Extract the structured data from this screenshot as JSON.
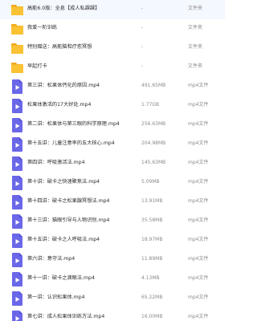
{
  "colors": {
    "folder": "#fbc233",
    "folder_tab": "#f0a91a",
    "video": "#6a67e8",
    "video_dark": "#5350d6",
    "text": "#2c2c2c",
    "muted": "#8a8a8a"
  },
  "files": [
    {
      "name": "高能6.0版：全息【成人私課課】",
      "size": "-",
      "type": "文件夹",
      "icon": "folder-icon"
    },
    {
      "name": "我爱一阶训练",
      "size": "-",
      "type": "文件夹",
      "icon": "folder-icon"
    },
    {
      "name": "特别赠送：高能脑和疗愈冥想",
      "size": "-",
      "type": "文件夹",
      "icon": "folder-icon"
    },
    {
      "name": "早起打卡",
      "size": "-",
      "type": "文件夹",
      "icon": "folder-icon"
    },
    {
      "name": "第三讲：松果体钙化的原因.mp4",
      "size": "491.65MB",
      "type": "mp4文件",
      "icon": "video-file-icon"
    },
    {
      "name": "松果体激活的17大好处.mp4",
      "size": "1.77GB",
      "type": "mp4文件",
      "icon": "video-file-icon"
    },
    {
      "name": "第二讲：松果体与第三眼的科学原理.mp4",
      "size": "256.63MB",
      "type": "mp4文件",
      "icon": "video-file-icon"
    },
    {
      "name": "第十五讲：儿童注意率的五大核心.mp4",
      "size": "204.98MB",
      "type": "mp4文件",
      "icon": "video-file-icon"
    },
    {
      "name": "第四讲：呼吸激活法.mp4",
      "size": "145.63MB",
      "type": "mp4文件",
      "icon": "video-file-icon"
    },
    {
      "name": "第十讲：破卡之快速聚焦法.mp4",
      "size": "5.09MB",
      "type": "mp4文件",
      "icon": "video-file-icon"
    },
    {
      "name": "第十四讲：破卡之松果腺冥想法.mp4",
      "size": "13.91MB",
      "type": "mp4文件",
      "icon": "video-file-icon"
    },
    {
      "name": "第十三讲：猫眼引导与人物识别.mp4",
      "size": "35.58MB",
      "type": "mp4文件",
      "icon": "video-file-icon"
    },
    {
      "name": "第十五讲：破卡之人呼吸法.mp4",
      "size": "18.97MB",
      "type": "mp4文件",
      "icon": "video-file-icon"
    },
    {
      "name": "第六讲：意守法.mp4",
      "size": "11.89MB",
      "type": "mp4文件",
      "icon": "video-file-icon"
    },
    {
      "name": "第十一讲：破卡之滴眼法.mp4",
      "size": "4.13MB",
      "type": "mp4文件",
      "icon": "video-file-icon"
    },
    {
      "name": "第一讲：认识松果体.mp4",
      "size": "65.22MB",
      "type": "mp4文件",
      "icon": "video-file-icon"
    },
    {
      "name": "第七讲：成人松果体训练方法.mp4",
      "size": "16.00MB",
      "type": "mp4文件",
      "icon": "video-file-icon"
    }
  ]
}
